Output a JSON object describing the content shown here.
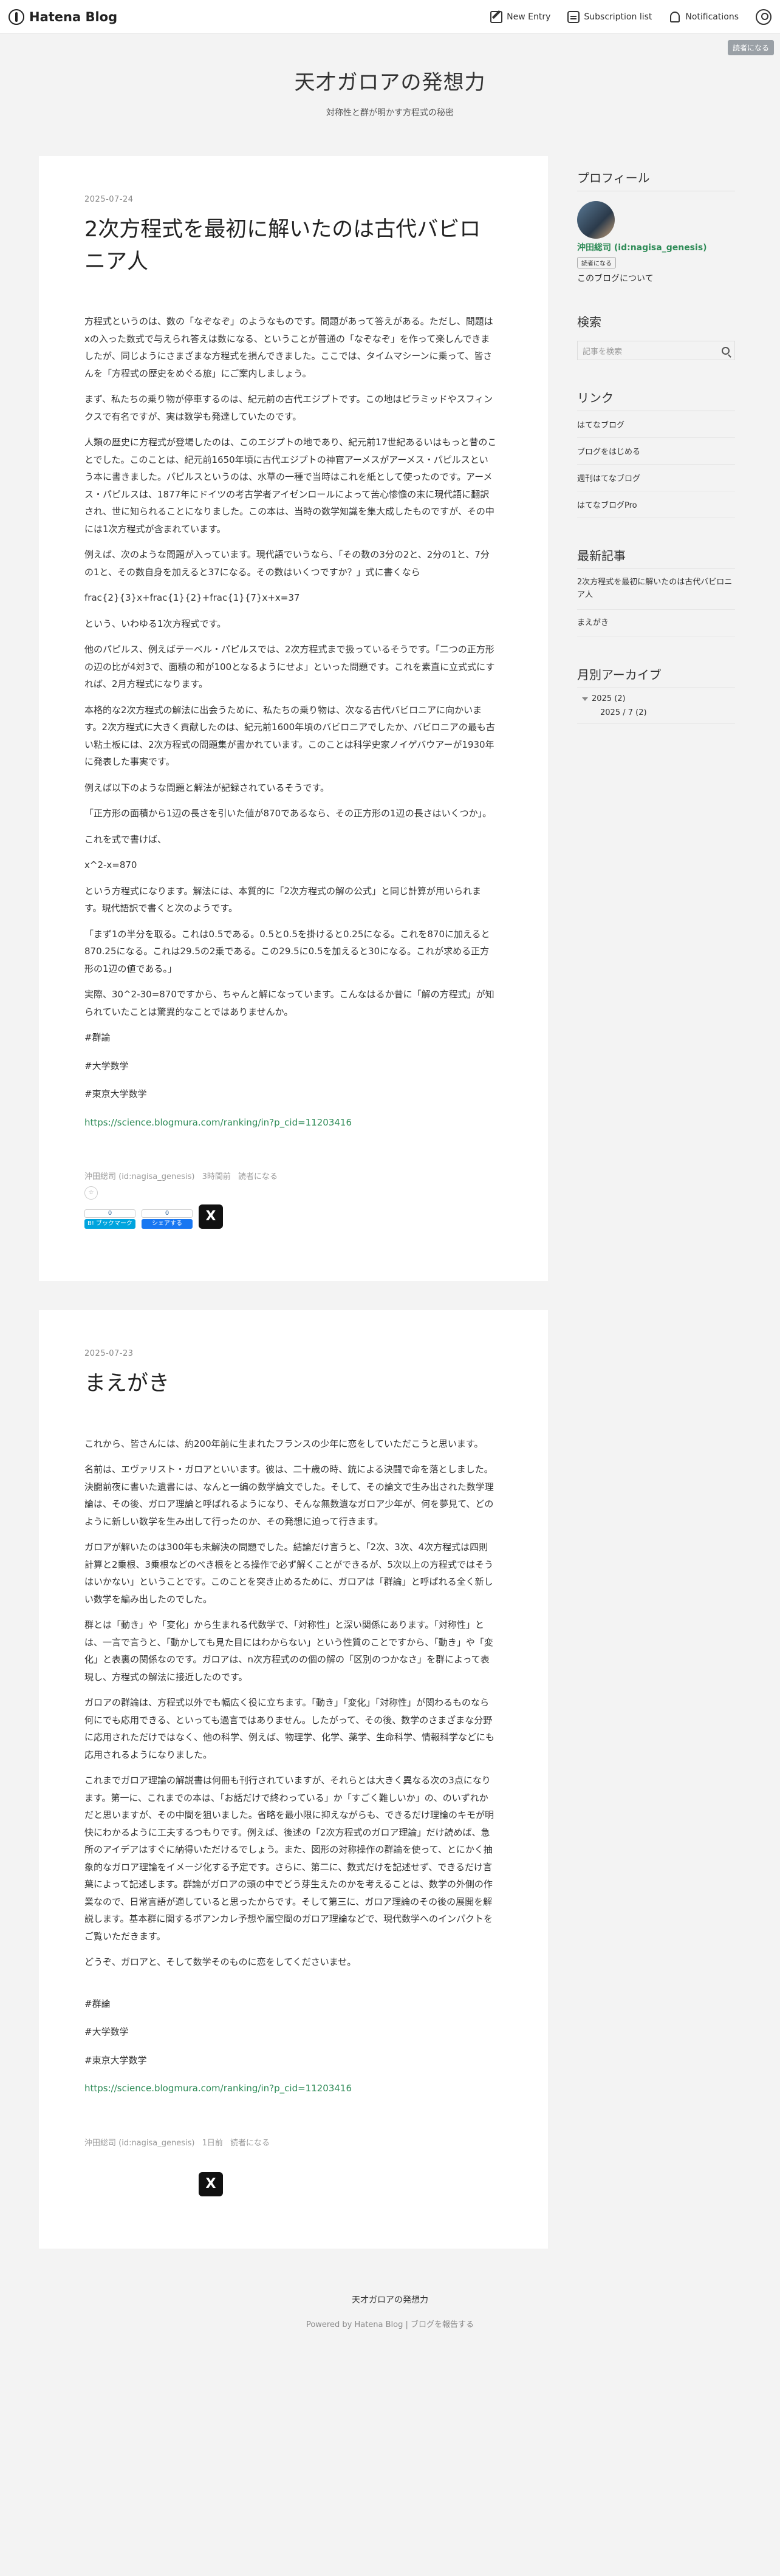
{
  "topbar": {
    "logo_text": "Hatena Blog",
    "new_entry": "New Entry",
    "subscription_list": "Subscription list",
    "notifications": "Notifications",
    "reader_badge": "読者になる"
  },
  "blog": {
    "title": "天才ガロアの発想力",
    "description": "対称性と群が明かす方程式の秘密"
  },
  "entries": [
    {
      "date": "2025-07-24",
      "title": "2次方程式を最初に解いたのは古代バビロニア人",
      "paragraphs": [
        "方程式というのは、数の「なぞなぞ」のようなものです。問題があって答えがある。ただし、問題はxの入った数式で与えられ答えは数になる、ということが普通の「なぞなぞ」を作って楽しんできましたが、同じようにさまざまな方程式を損んできました。ここでは、タイムマシーンに乗って、皆さんを「方程式の歴史をめぐる旅」にご案内しましょう。",
        "まず、私たちの乗り物が停車するのは、紀元前の古代エジプトです。この地はピラミッドやスフィンクスで有名ですが、実は数学も発達していたのです。",
        "人類の歴史に方程式が登場したのは、このエジプトの地であり、紀元前17世紀あるいはもっと昔のことでした。このことは、紀元前1650年頃に古代エジプトの神官アーメスがアーメス・パピルスという本に書きました。パピルスというのは、水草の一種で当時はこれを紙として使ったのです。アーメス・パピルスは、1877年にドイツの考古学者アイゼンロールによって苦心惨憺の末に現代語に翻訳され、世に知られることになりました。この本は、当時の数学知識を集大成したものですが、その中には1次方程式が含まれています。",
        "例えば、次のような問題が入っています。現代語でいうなら、「その数の3分の2と、2分の1と、7分の1と、その数自身を加えると37になる。その数はいくつですか？」式に書くなら",
        "frac{2}{3}x+frac{1}{2}+frac{1}{7}x+x=37",
        "という、いわゆる1次方程式です。",
        "他のパピルス、例えばテーベル・パピルスでは、2次方程式まで扱っているそうです。「二つの正方形の辺の比が4対3で、面積の和が100となるようにせよ」といった問題です。これを素直に立式式にすれば、2月方程式になります。",
        "本格的な2次方程式の解法に出会うために、私たちの乗り物は、次なる古代バビロニアに向かいます。2次方程式に大きく貢献したのは、紀元前1600年頃のバビロニアでしたか、バビロニアの最も古い粘土板には、2次方程式の問題集が書かれています。このことは科学史家ノイゲバウアーが1930年に発表した事実です。",
        "例えば以下のような問題と解法が記録されているそうです。",
        "「正方形の面積から1辺の長さを引いた値が870であるなら、その正方形の1辺の長さはいくつか」。",
        "これを式で書けば、",
        "x^2-x=870",
        "という方程式になります。解法には、本質的に「2次方程式の解の公式」と同じ計算が用いられます。現代語訳で書くと次のようです。",
        "「まず1の半分を取る。これは0.5である。0.5と0.5を掛けると0.25になる。これを870に加えると870.25になる。これは29.5の2乗である。この29.5に0.5を加えると30になる。これが求める正方形の1辺の値である。」",
        "実際、30^2-30=870ですから、ちゃんと解になっています。こんなはるか昔に「解の方程式」が知られていたことは驚異的なことではありませんか。"
      ],
      "tags": [
        "#群論",
        "#大学数学",
        "#東京大学数学"
      ],
      "link": "https://science.blogmura.com/ranking/in?p_cid=11203416",
      "author": "沖田総司 (id:nagisa_genesis)",
      "time_ago": "3時間前",
      "reader": "読者になる",
      "star": "☆",
      "bookmark_count": "0",
      "bookmark_label": "B! ブックマーク",
      "fb_count": "0",
      "fb_label": "シェアする",
      "x_label": "X"
    },
    {
      "date": "2025-07-23",
      "title": "まえがき",
      "paragraphs": [
        "これから、皆さんには、約200年前に生まれたフランスの少年に恋をしていただこうと思います。",
        "名前は、エヴァリスト・ガロアといいます。彼は、二十歳の時、銃による決闘で命を落としました。決闘前夜に書いた遺書には、なんと一編の数学論文でした。そして、その論文で生み出された数学理論は、その後、ガロア理論と呼ばれるようになり、そんな無数遺なガロア少年が、何を夢見て、どのように新しい数学を生み出して行ったのか、その発想に迫って行きます。",
        "ガロアが解いたのは300年も未解決の問題でした。結論だけ言うと、「2次、3次、4次方程式は四則計算と2乗根、3乗根などのべき根をとる操作で必ず解くことができるが、5次以上の方程式ではそうはいかない」ということです。このことを突き止めるために、ガロアは「群論」と呼ばれる全く新しい数学を編み出したのでした。",
        "群とは「動き」や「変化」から生まれる代数学で、「対称性」と深い関係にあります。「対称性」とは、一言で言うと、「動かしても見た目にはわからない」という性質のことですから、「動き」や「変化」と表裏の関係なのです。ガロアは、n次方程式のの個の解の「区別のつかなさ」を群によって表現し、方程式の解法に接近したのです。",
        "ガロアの群論は、方程式以外でも幅広く役に立ちます。「動き」「変化」「対称性」が関わるものなら何にでも応用できる、といっても過言ではありません。したがって、その後、数学のさまざまな分野に応用されただけではなく、他の科学、例えば、物理学、化学、薬学、生命科学、情報科学などにも応用されるようになりました。",
        "これまでガロア理論の解説書は何冊も刊行されていますが、それらとは大きく異なる次の3点になります。第一に、これまでの本は、「お話だけで終わっている」か「すごく難しいか」の、のいずれかだと思いますが、その中間を狙いました。省略を最小限に抑えながらも、できるだけ理論のキモが明快にわかるように工夫するつもりです。例えば、後述の「2次方程式のガロア理論」だけ読めば、急所のアイデアはすぐに納得いただけるでしょう。また、図形の対称操作の群論を使って、とにかく抽象的なガロア理論をイメージ化する予定です。さらに、第二に、数式だけを記述せず、できるだけ言葉によって記述します。群論がガロアの頭の中でどう芽生えたのかを考えることは、数学の外側の作業なので、日常言語が適していると思ったからです。そして第三に、ガロア理論のその後の展開を解説します。基本群に関するポアンカレ予想や層空間のガロア理論などで、現代数学へのインパクトをご覧いただきます。",
        "どうぞ、ガロアと、そして数学そのものに恋をしてくださいませ。"
      ],
      "tags": [
        "#群論",
        "#大学数学",
        "#東京大学数学"
      ],
      "link": "https://science.blogmura.com/ranking/in?p_cid=11203416",
      "author": "沖田総司 (id:nagisa_genesis)",
      "time_ago": "1日前",
      "reader": "読者になる",
      "x_label": "X"
    }
  ],
  "sidebar": {
    "profile_title": "プロフィール",
    "profile_name": "沖田総司 (id:nagisa_genesis)",
    "follow_label": "読者になる",
    "about_label": "このブログについて",
    "search_title": "検索",
    "search_placeholder": "記事を検索",
    "links_title": "リンク",
    "links": [
      "はてなブログ",
      "ブログをはじめる",
      "週刊はてなブログ",
      "はてなブログPro"
    ],
    "recent_title": "最新記事",
    "recent": [
      "2次方程式を最初に解いたのは古代バビロニア人",
      "まえがき"
    ],
    "archive_title": "月別アーカイブ",
    "archive_year": "2025 (2)",
    "archive_month": "2025 / 7 (2)"
  },
  "footer": {
    "blog_title": "天才ガロアの発想力",
    "powered": "Powered by Hatena Blog | ブログを報告する"
  }
}
